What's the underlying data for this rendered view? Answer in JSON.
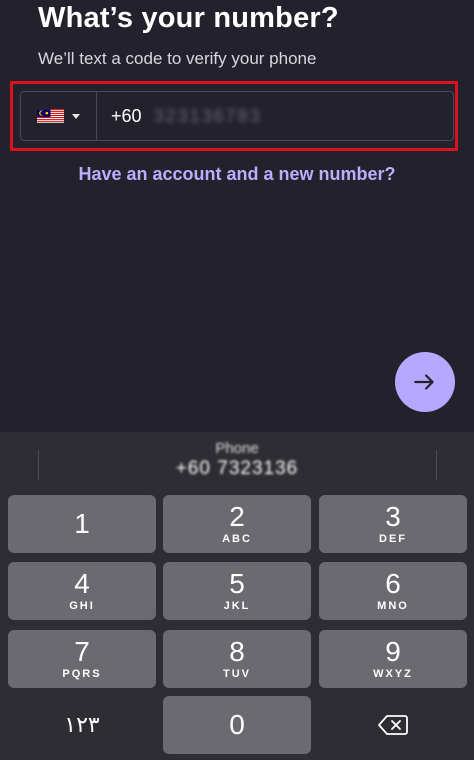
{
  "header": {
    "title": "What’s your number?",
    "subtitle": "We’ll text a code to verify your phone"
  },
  "phone_input": {
    "country_flag": "malaysia-flag-icon",
    "country_code": "+60",
    "number_value": "323136783"
  },
  "link": {
    "text": "Have an account and a new number?"
  },
  "next_button": {
    "icon": "arrow-right-icon",
    "color": "#b7a8ff"
  },
  "keyboard": {
    "suggestion_label": "Phone",
    "suggestion_value": "+60 7323136",
    "keys": [
      {
        "digit": "1",
        "letters": ""
      },
      {
        "digit": "2",
        "letters": "ABC"
      },
      {
        "digit": "3",
        "letters": "DEF"
      },
      {
        "digit": "4",
        "letters": "GHI"
      },
      {
        "digit": "5",
        "letters": "JKL"
      },
      {
        "digit": "6",
        "letters": "MNO"
      },
      {
        "digit": "7",
        "letters": "PQRS"
      },
      {
        "digit": "8",
        "letters": "TUV"
      },
      {
        "digit": "9",
        "letters": "WXYZ"
      },
      {
        "digit": "0",
        "letters": ""
      }
    ],
    "alt_key_label": "۱۲۳",
    "delete_icon": "backspace-icon"
  },
  "colors": {
    "background": "#23222c",
    "accent": "#bcaeff",
    "highlight_border": "#d9141e",
    "key": "#6a6a70"
  }
}
